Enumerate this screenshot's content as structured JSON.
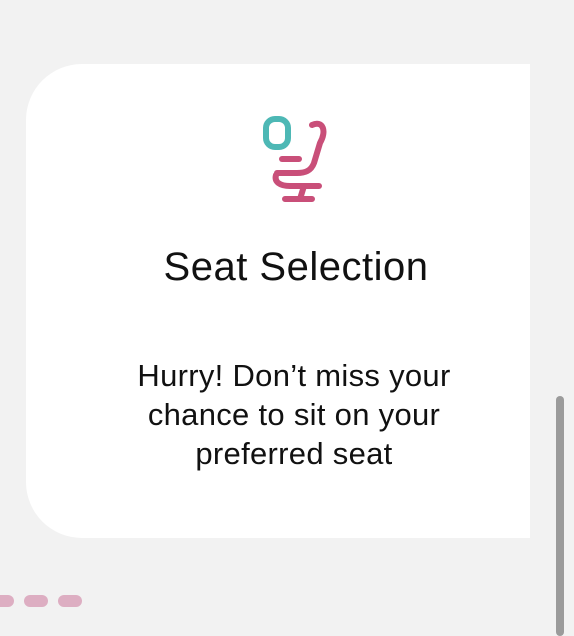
{
  "card": {
    "icon": "airplane-seat-icon",
    "title": "Seat Selection",
    "description": "Hurry! Don’t miss your chance to sit on your preferred seat"
  },
  "pager": {
    "dots": 3
  },
  "colors": {
    "icon_seat": "#c94f79",
    "icon_window": "#4db8b5",
    "pager_dot": "#ddaec2",
    "scrollbar": "#9b9b9b",
    "background": "#f2f2f2",
    "card": "#ffffff"
  }
}
